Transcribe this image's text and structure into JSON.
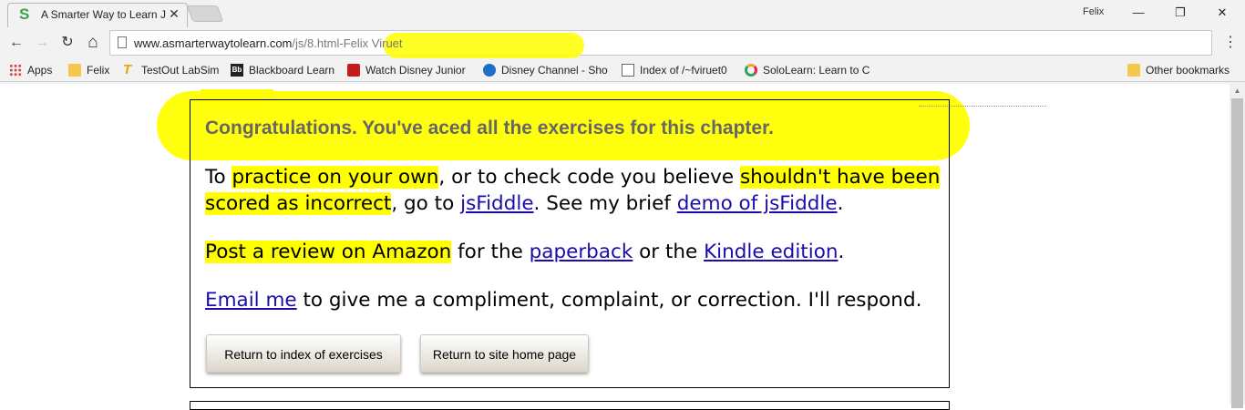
{
  "browser": {
    "tab_title": "A Smarter Way to Learn J",
    "tab_favicon": "S",
    "close_glyph": "✕",
    "profile": "Felix",
    "window": {
      "minimize": "—",
      "restore": "❐",
      "close": "✕"
    },
    "nav": {
      "back": "←",
      "forward": "→",
      "reload": "↻",
      "home": "⌂",
      "menu": "⋮"
    },
    "url_host": "www.asmarterwaytolearn.com",
    "url_path": "/js/8.html-Felix Viruet"
  },
  "bookmarks": [
    {
      "label": "Apps",
      "icon": "apps-grid-icon"
    },
    {
      "label": "Felix",
      "icon": "folder-icon"
    },
    {
      "label": "TestOut LabSim",
      "icon": "testout-icon",
      "glyph": "T"
    },
    {
      "label": "Blackboard Learn",
      "icon": "blackboard-icon",
      "glyph": "Bb"
    },
    {
      "label": "Watch Disney Junior",
      "icon": "disney-junior-icon"
    },
    {
      "label": "Disney Channel - Sho",
      "icon": "disney-channel-icon"
    },
    {
      "label": "Index of /~fviruet0",
      "icon": "page-icon"
    },
    {
      "label": "SoloLearn: Learn to C",
      "icon": "sololearn-icon"
    },
    {
      "label": "Other bookmarks",
      "icon": "folder-icon"
    }
  ],
  "page": {
    "congrats": "Congratulations. You've aced all the exercises for this chapter.",
    "p1": {
      "to": "To ",
      "practice": "practice on your own",
      "mid": ", or to check code you believe ",
      "shouldnt": "shouldn't have been",
      "scored": "scored as incorrect",
      "goto": ", go to ",
      "jsfiddle": "jsFiddle",
      "see": ". See my brief ",
      "demo": "demo of jsFiddle",
      "end": "."
    },
    "p2": {
      "post": "Post a review on Amazon",
      "for": " for the ",
      "paperback": "paperback",
      "or": " or the ",
      "kindle": "Kindle edition",
      "end": "."
    },
    "p3": {
      "email": "Email me",
      "rest": " to give me a compliment, complaint, or correction. I'll respond."
    },
    "buttons": {
      "index": "Return to index of exercises",
      "home": "Return to site home page"
    }
  },
  "colors": {
    "highlight": "#ffff00",
    "link": "#1a0dab",
    "heading": "#666666"
  }
}
